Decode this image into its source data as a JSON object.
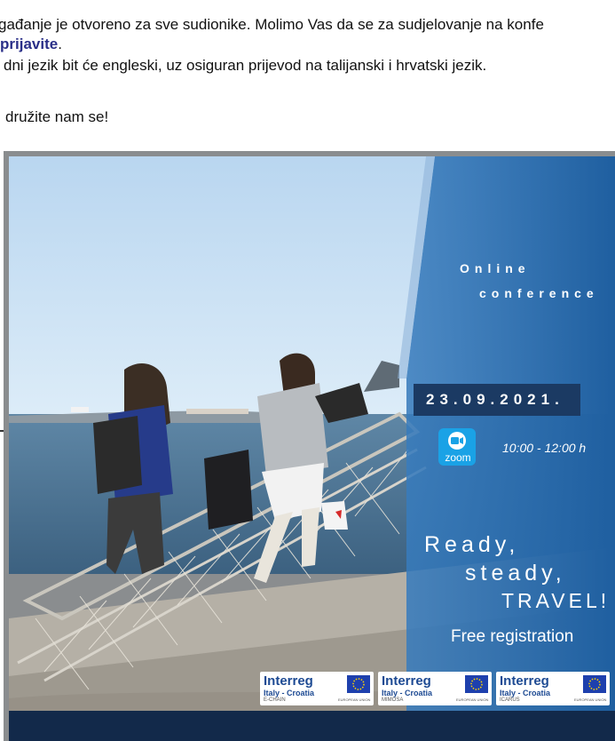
{
  "intro": {
    "line1": "gađanje je otvoreno za sve sudionike. Molimo Vas da se za sudjelovanje na konfe",
    "register_link": "prijavite",
    "register_suffix": ".",
    "line3": "dni jezik bit će engleski, uz osiguran prijevod na talijanski i hrvatski jezik.",
    "line4": "družite nam se!"
  },
  "poster": {
    "online": "Online",
    "conference": "conference",
    "date": "23.09.2021.",
    "zoom_label": "zoom",
    "time": "10:00 - 12:00 h",
    "ready": "Ready,",
    "steady": "steady,",
    "travel": "TRAVEL!",
    "free_registration": "Free registration",
    "logos": [
      {
        "brand": "Interreg",
        "sub": "Italy - Croatia",
        "project": "E-CHAIN",
        "eu": "EUROPEAN UNION"
      },
      {
        "brand": "Interreg",
        "sub": "Italy - Croatia",
        "project": "MIMOSA",
        "eu": "EUROPEAN UNION"
      },
      {
        "brand": "Interreg",
        "sub": "Italy - Croatia",
        "project": "ICARUS",
        "eu": "EUROPEAN UNION"
      }
    ]
  },
  "colors": {
    "link": "#2a2f88",
    "panel_blue": "#1f5fa0",
    "date_box": "#1b3a63",
    "zoom": "#1aa2e6",
    "eu_blue": "#1e40ad",
    "eu_star": "#ffd400"
  }
}
